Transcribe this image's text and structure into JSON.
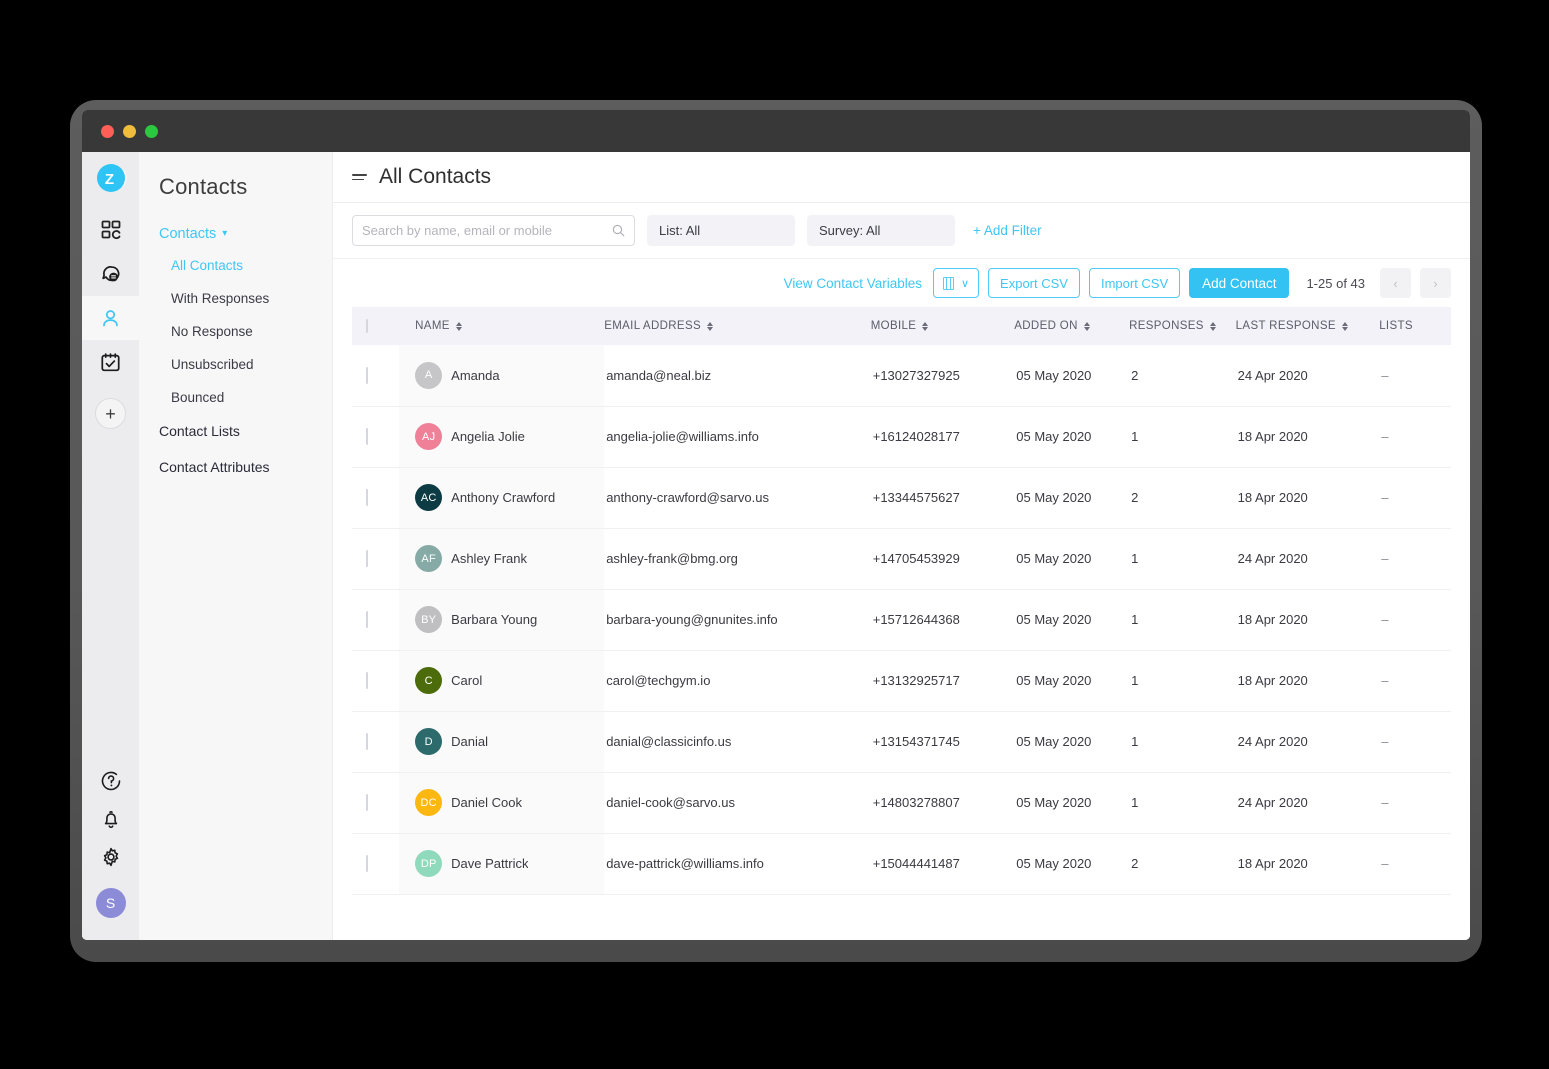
{
  "window": {
    "traffic_lights": [
      "close",
      "minimize",
      "maximize"
    ]
  },
  "rail": {
    "logo": "zoho-z-logo",
    "items": [
      {
        "name": "dashboard-grid-icon",
        "active": false
      },
      {
        "name": "conversations-icon",
        "active": false
      },
      {
        "name": "contacts-person-icon",
        "active": true
      },
      {
        "name": "surveys-calendar-icon",
        "active": false
      }
    ],
    "add_label": "+",
    "bottom_items": [
      {
        "name": "help-icon"
      },
      {
        "name": "notifications-bell-icon"
      },
      {
        "name": "settings-gear-icon"
      }
    ],
    "user_initial": "S"
  },
  "sidebar": {
    "title": "Contacts",
    "group_label": "Contacts",
    "sub_items": [
      {
        "label": "All Contacts",
        "active": true
      },
      {
        "label": "With Responses",
        "active": false
      },
      {
        "label": "No Response",
        "active": false
      },
      {
        "label": "Unsubscribed",
        "active": false
      },
      {
        "label": "Bounced",
        "active": false
      }
    ],
    "top_items": [
      {
        "label": "Contact Lists"
      },
      {
        "label": "Contact Attributes"
      }
    ]
  },
  "header": {
    "page_title": "All Contacts"
  },
  "filters": {
    "search_placeholder": "Search by name, email or mobile",
    "search_value": "",
    "list_filter": "List: All",
    "survey_filter": "Survey: All",
    "add_filter": "+ Add Filter"
  },
  "actions": {
    "view_contact_variables": "View Contact Variables",
    "columns_chevron": "∨",
    "export_csv": "Export CSV",
    "import_csv": "Import CSV",
    "add_contact": "Add Contact",
    "page_count": "1-25 of 43",
    "prev": "‹",
    "next": "›"
  },
  "table": {
    "columns": [
      {
        "key": "name",
        "label": "NAME",
        "sortable": true
      },
      {
        "key": "email",
        "label": "EMAIL ADDRESS",
        "sortable": true
      },
      {
        "key": "mobile",
        "label": "MOBILE",
        "sortable": true
      },
      {
        "key": "added",
        "label": "ADDED ON",
        "sortable": true
      },
      {
        "key": "resp",
        "label": "RESPONSES",
        "sortable": true
      },
      {
        "key": "last",
        "label": "LAST RESPONSE",
        "sortable": true
      },
      {
        "key": "lists",
        "label": "LISTS",
        "sortable": false
      }
    ],
    "rows": [
      {
        "initials": "A",
        "color": "#c6c6c8",
        "name": "Amanda",
        "email": "amanda@neal.biz",
        "mobile": "+13027327925",
        "added": "05 May 2020",
        "responses": "2",
        "last_response": "24 Apr 2020",
        "lists": "–"
      },
      {
        "initials": "AJ",
        "color": "#ef8098",
        "name": "Angelia Jolie",
        "email": "angelia-jolie@williams.info",
        "mobile": "+16124028177",
        "added": "05 May 2020",
        "responses": "1",
        "last_response": "18 Apr 2020",
        "lists": "–"
      },
      {
        "initials": "AC",
        "color": "#0d3b44",
        "name": "Anthony Crawford",
        "email": "anthony-crawford@sarvo.us",
        "mobile": "+13344575627",
        "added": "05 May 2020",
        "responses": "2",
        "last_response": "18 Apr 2020",
        "lists": "–"
      },
      {
        "initials": "AF",
        "color": "#86aaa6",
        "name": "Ashley Frank",
        "email": "ashley-frank@bmg.org",
        "mobile": "+14705453929",
        "added": "05 May 2020",
        "responses": "1",
        "last_response": "24 Apr 2020",
        "lists": "–"
      },
      {
        "initials": "BY",
        "color": "#bfbfc1",
        "name": "Barbara Young",
        "email": "barbara-young@gnunites.info",
        "mobile": "+15712644368",
        "added": "05 May 2020",
        "responses": "1",
        "last_response": "18 Apr 2020",
        "lists": "–"
      },
      {
        "initials": "C",
        "color": "#4c6b0a",
        "name": "Carol",
        "email": "carol@techgym.io",
        "mobile": "+13132925717",
        "added": "05 May 2020",
        "responses": "1",
        "last_response": "18 Apr 2020",
        "lists": "–"
      },
      {
        "initials": "D",
        "color": "#2c6a6b",
        "name": "Danial",
        "email": "danial@classicinfo.us",
        "mobile": "+13154371745",
        "added": "05 May 2020",
        "responses": "1",
        "last_response": "24 Apr 2020",
        "lists": "–"
      },
      {
        "initials": "DC",
        "color": "#fcb711",
        "name": "Daniel Cook",
        "email": "daniel-cook@sarvo.us",
        "mobile": "+14803278807",
        "added": "05 May 2020",
        "responses": "1",
        "last_response": "24 Apr 2020",
        "lists": "–"
      },
      {
        "initials": "DP",
        "color": "#8fd9bc",
        "name": "Dave Pattrick",
        "email": "dave-pattrick@williams.info",
        "mobile": "+15044441487",
        "added": "05 May 2020",
        "responses": "2",
        "last_response": "18 Apr 2020",
        "lists": "–"
      }
    ]
  },
  "colors": {
    "accent": "#3fc6f5",
    "primary_button": "#33c2f2",
    "header_bg": "#f2f2f8",
    "rail_bg": "#ececee",
    "sidebar_bg": "#f7f7f8",
    "titlebar": "#383838"
  }
}
